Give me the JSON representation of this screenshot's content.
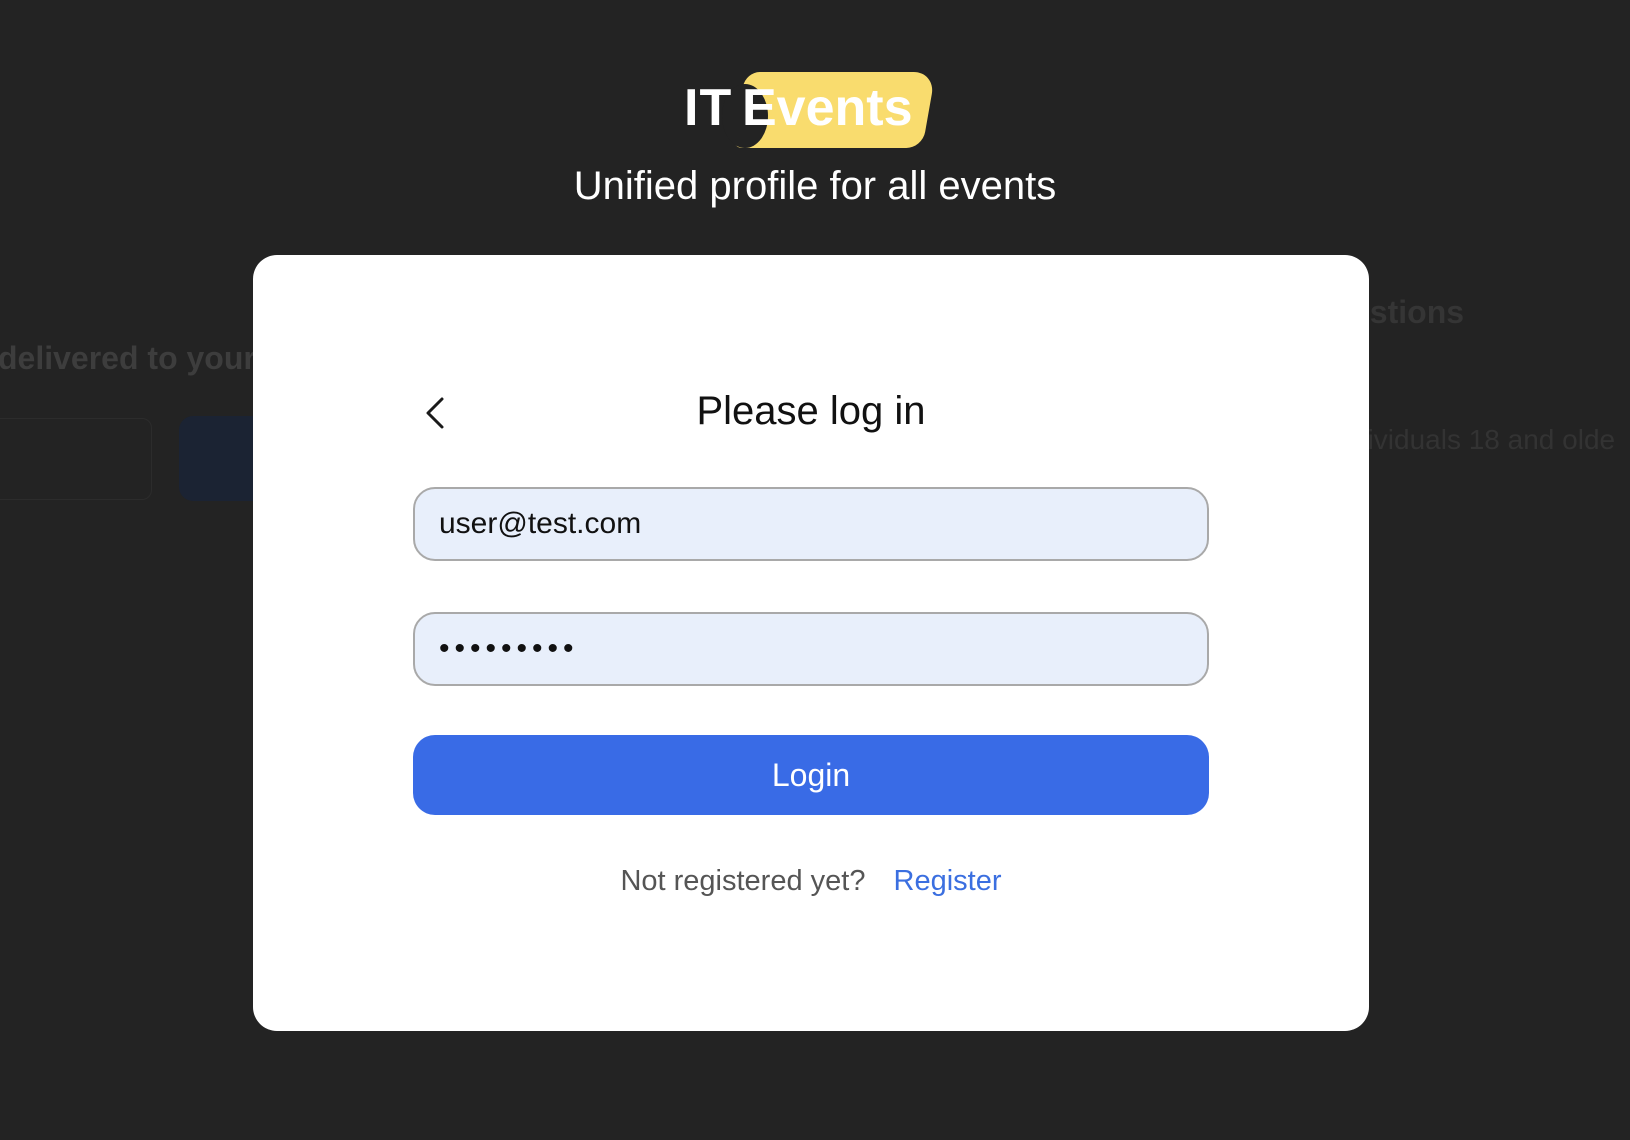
{
  "background": {
    "left_heading": "delivered to your i",
    "right_heading": "estions",
    "right_line": "dividuals 18 and olde"
  },
  "header": {
    "logo_it": "IT",
    "logo_events": "Events",
    "tagline": "Unified profile for all events"
  },
  "login_modal": {
    "back_icon": "chevron-left-icon",
    "title": "Please log in",
    "email_value": "user@test.com",
    "password_value": "•••••••••",
    "login_label": "Login",
    "register_prompt": "Not registered yet?",
    "register_link": "Register"
  },
  "colors": {
    "page_background": "#232323",
    "modal_background": "#ffffff",
    "field_background": "#e8effb",
    "primary_button": "#396be6",
    "link": "#3b6fe0",
    "logo_badge": "#f9dc6e"
  }
}
